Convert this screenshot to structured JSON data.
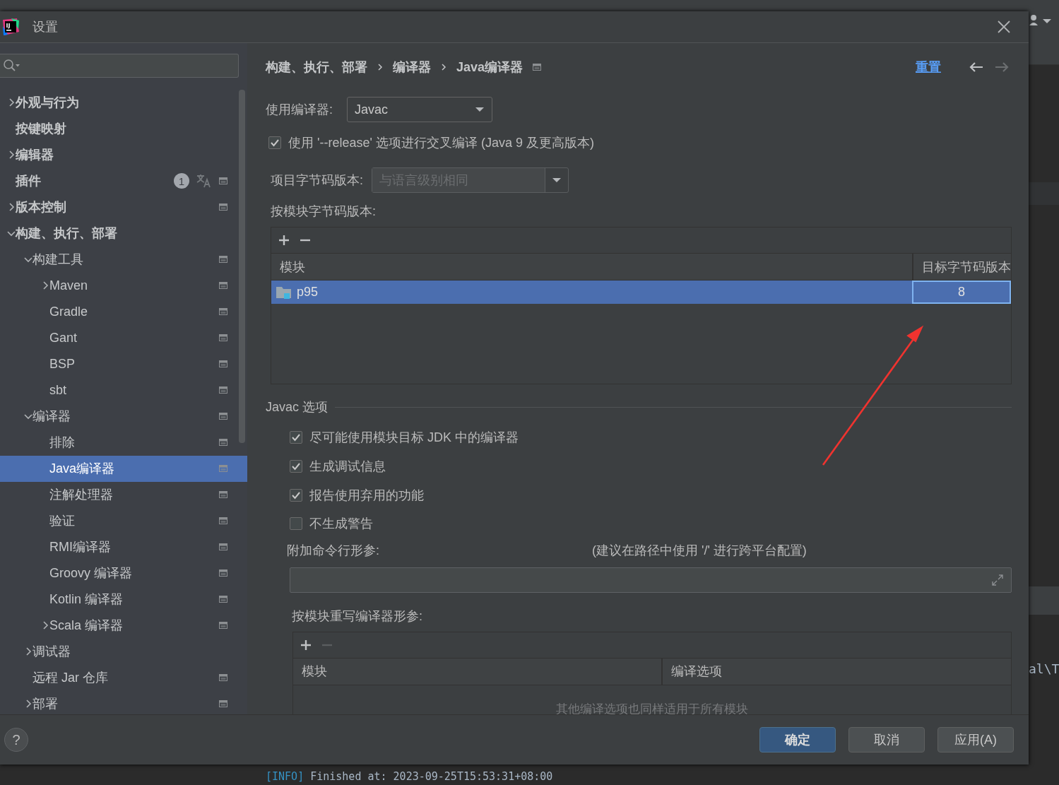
{
  "window": {
    "title": "设置"
  },
  "sidebar": {
    "items": [
      {
        "label": "外观与行为",
        "expanded": false,
        "selected": false
      },
      {
        "label": "按键映射",
        "selected": false
      },
      {
        "label": "编辑器",
        "expanded": false,
        "selected": false
      },
      {
        "label": "插件",
        "badge": "1",
        "translate": true,
        "project_scoped": true,
        "selected": false
      },
      {
        "label": "版本控制",
        "expanded": false,
        "project_scoped": true,
        "selected": false
      },
      {
        "label": "构建、执行、部署",
        "expanded": true,
        "selected": false,
        "children": [
          {
            "label": "构建工具",
            "expanded": true,
            "project_scoped": true,
            "selected": false,
            "children": [
              {
                "label": "Maven",
                "expanded": false,
                "project_scoped": true,
                "selected": false
              },
              {
                "label": "Gradle",
                "project_scoped": true,
                "selected": false
              },
              {
                "label": "Gant",
                "project_scoped": true,
                "selected": false
              },
              {
                "label": "BSP",
                "project_scoped": true,
                "selected": false
              },
              {
                "label": "sbt",
                "project_scoped": true,
                "selected": false
              }
            ]
          },
          {
            "label": "编译器",
            "expanded": true,
            "project_scoped": true,
            "selected": false,
            "children": [
              {
                "label": "排除",
                "project_scoped": true,
                "selected": false
              },
              {
                "label": "Java编译器",
                "project_scoped": true,
                "selected": true
              },
              {
                "label": "注解处理器",
                "project_scoped": true,
                "selected": false
              },
              {
                "label": "验证",
                "project_scoped": true,
                "selected": false
              },
              {
                "label": "RMI编译器",
                "project_scoped": true,
                "selected": false
              },
              {
                "label": "Groovy 编译器",
                "project_scoped": true,
                "selected": false
              },
              {
                "label": "Kotlin 编译器",
                "project_scoped": true,
                "selected": false
              },
              {
                "label": "Scala 编译器",
                "expanded": false,
                "project_scoped": true,
                "selected": false
              }
            ]
          },
          {
            "label": "调试器",
            "expanded": false,
            "selected": false
          },
          {
            "label": "远程 Jar 仓库",
            "project_scoped": true,
            "selected": false
          },
          {
            "label": "部署",
            "expanded": false,
            "project_scoped": true,
            "selected": false
          }
        ]
      }
    ]
  },
  "breadcrumb": [
    "构建、执行、部署",
    "编译器",
    "Java编译器"
  ],
  "reset_link": "重置",
  "nav": [
    {
      "kind": "back",
      "disabled": false
    },
    {
      "kind": "forward",
      "disabled": true
    }
  ],
  "compiler": {
    "label": "使用编译器:",
    "value": "Javac"
  },
  "release_option": {
    "label": "使用 '--release' 选项进行交叉编译 (Java 9 及更高版本)",
    "checked": true
  },
  "project_bytecode": {
    "label": "项目字节码版本:",
    "placeholder": "与语言级别相同"
  },
  "module_bytecode": {
    "label": "按模块字节码版本:",
    "toolbar": [
      {
        "kind": "add",
        "disabled": false
      },
      {
        "kind": "remove",
        "disabled": false
      }
    ],
    "columns": [
      "模块",
      "目标字节码版本"
    ],
    "rows": [
      {
        "module": "p95",
        "version": "8",
        "selected": true
      }
    ]
  },
  "javac_options": {
    "title": "Javac 选项",
    "checkboxes": [
      {
        "label": "尽可能使用模块目标 JDK 中的编译器",
        "checked": true
      },
      {
        "label": "生成调试信息",
        "checked": true
      },
      {
        "label": "报告使用弃用的功能",
        "checked": true
      },
      {
        "label": "不生成警告",
        "checked": false
      }
    ],
    "args_label": "附加命令行形参:",
    "args_hint": "(建议在路径中使用 '/' 进行跨平台配置)",
    "override": {
      "label": "按模块重写编译器形参:",
      "toolbar": [
        {
          "kind": "add",
          "disabled": false
        },
        {
          "kind": "remove",
          "disabled": true
        }
      ],
      "columns": [
        "模块",
        "编译选项"
      ],
      "empty_text": "其他编译选项也同样适用于所有模块"
    }
  },
  "help": "?",
  "buttons": [
    {
      "label": "确定",
      "kind": "primary"
    },
    {
      "label": "取消",
      "kind": "normal"
    },
    {
      "label": "应用(A)",
      "kind": "normal"
    }
  ],
  "background": {
    "console_fragment": "al\\T",
    "log_tag": "[INFO]",
    "log_text": "Finished at: 2023-09-25T15:53:31+08:00"
  }
}
